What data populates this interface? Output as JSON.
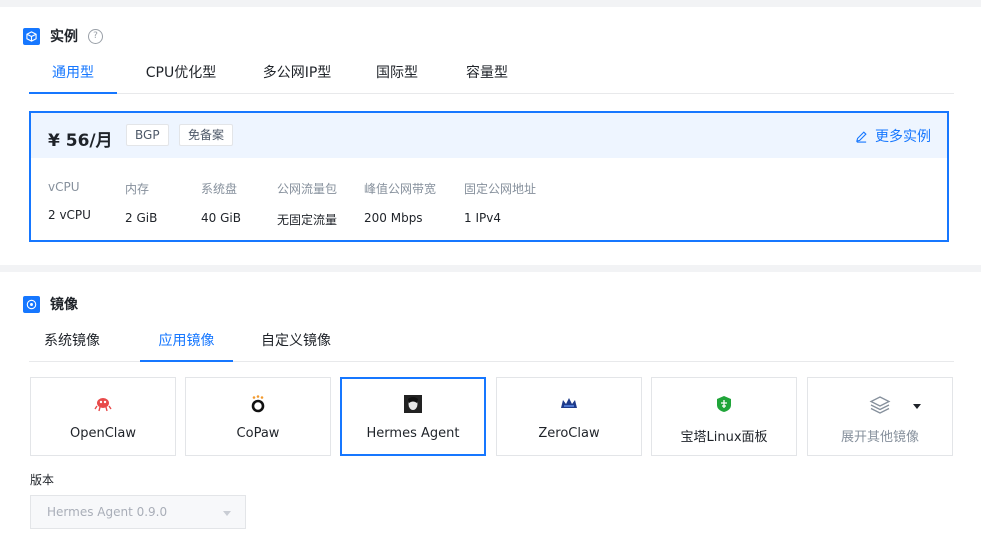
{
  "instance": {
    "title": "实例",
    "tabs": [
      "通用型",
      "CPU优化型",
      "多公网IP型",
      "国际型",
      "容量型"
    ],
    "active_tab": 0,
    "plan": {
      "price": "¥ 56/月",
      "tags": [
        "BGP",
        "免备案"
      ],
      "more_link": "更多实例",
      "specs": [
        {
          "label": "vCPU",
          "value": "2 vCPU"
        },
        {
          "label": "内存",
          "value": "2 GiB"
        },
        {
          "label": "系统盘",
          "value": "40 GiB"
        },
        {
          "label": "公网流量包",
          "value": "无固定流量"
        },
        {
          "label": "峰值公网带宽",
          "value": "200 Mbps"
        },
        {
          "label": "固定公网地址",
          "value": "1 IPv4"
        }
      ]
    }
  },
  "image": {
    "title": "镜像",
    "tabs": [
      "系统镜像",
      "应用镜像",
      "自定义镜像"
    ],
    "active_tab": 1,
    "apps": [
      {
        "name": "OpenClaw",
        "icon": "openclaw-icon",
        "selected": false
      },
      {
        "name": "CoPaw",
        "icon": "copaw-icon",
        "selected": false
      },
      {
        "name": "Hermes Agent",
        "icon": "hermes-agent-icon",
        "selected": true
      },
      {
        "name": "ZeroClaw",
        "icon": "zeroclaw-icon",
        "selected": false
      },
      {
        "name": "宝塔Linux面板",
        "icon": "baota-icon",
        "selected": false
      },
      {
        "name": "展开其他镜像",
        "icon": "layers-icon",
        "selected": false
      }
    ],
    "version_label": "版本",
    "version_value": "Hermes Agent 0.9.0"
  },
  "colors": {
    "accent": "#1677ff",
    "selected_bg": "#eef5ff"
  }
}
